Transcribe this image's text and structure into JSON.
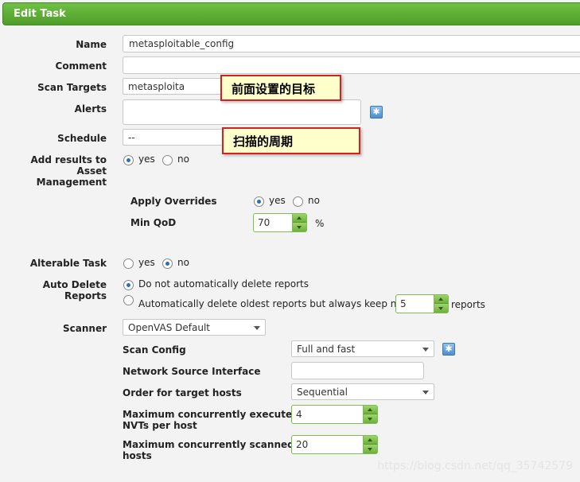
{
  "title": "Edit Task",
  "form": {
    "name": {
      "label": "Name",
      "value": "metasploitable_config"
    },
    "comment": {
      "label": "Comment",
      "value": ""
    },
    "scan_targets": {
      "label": "Scan Targets",
      "value": "metasploita"
    },
    "alerts": {
      "label": "Alerts"
    },
    "schedule": {
      "label": "Schedule",
      "value": "--"
    },
    "add_results": {
      "label_l1": "Add results to",
      "label_l2": "Asset",
      "label_l3": "Management",
      "yes": "yes",
      "no": "no",
      "selected": "yes"
    },
    "apply_overrides": {
      "label": "Apply Overrides",
      "yes": "yes",
      "no": "no",
      "selected": "yes"
    },
    "min_qod": {
      "label": "Min QoD",
      "value": "70",
      "unit": "%"
    },
    "alterable_task": {
      "label": "Alterable Task",
      "yes": "yes",
      "no": "no",
      "selected": "no"
    },
    "auto_delete": {
      "label_l1": "Auto Delete",
      "label_l2": "Reports",
      "option1": "Do not automatically delete reports",
      "option2": "Automatically delete oldest reports but always keep newest",
      "keep_value": "5",
      "keep_unit": "reports",
      "selected": "option1"
    },
    "scanner": {
      "label": "Scanner",
      "value": "OpenVAS Default"
    },
    "scan_config": {
      "label": "Scan Config",
      "value": "Full and fast"
    },
    "network_source_interface": {
      "label": "Network Source Interface",
      "value": ""
    },
    "order_target_hosts": {
      "label": "Order for target hosts",
      "value": "Sequential"
    },
    "max_nvts": {
      "label_l1": "Maximum concurrently executed",
      "label_l2": "NVTs per host",
      "value": "4"
    },
    "max_hosts": {
      "label_l1": "Maximum concurrently scanned",
      "label_l2": "hosts",
      "value": "20"
    }
  },
  "annotations": {
    "targets_note": "前面设置的目标",
    "schedule_note": "扫描的周期"
  },
  "watermark": "https://blog.csdn.net/qq_35742579",
  "colors": {
    "title_bar": "#5aae34",
    "note_border": "#d42020",
    "note_bg": "#ffffcc"
  },
  "icons": {
    "new_alert": "star-icon",
    "new_scan_config": "star-icon"
  }
}
